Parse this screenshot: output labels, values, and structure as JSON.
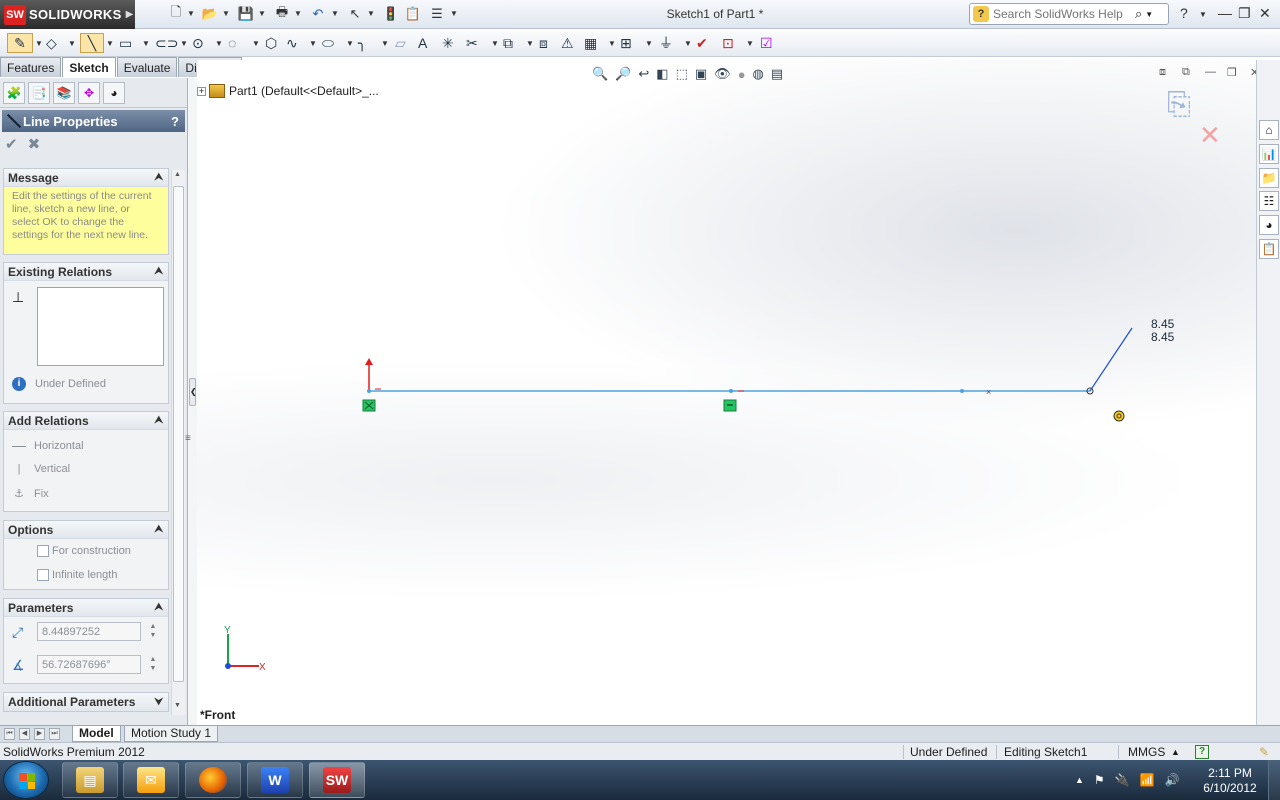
{
  "app": {
    "brand": "SOLIDWORKS",
    "document_title": "Sketch1 of Part1 *",
    "search_placeholder": "Search SolidWorks Help",
    "help_symbol": "?"
  },
  "command_tabs": [
    {
      "label": "Features",
      "active": false
    },
    {
      "label": "Sketch",
      "active": true
    },
    {
      "label": "Evaluate",
      "active": false
    },
    {
      "label": "DimXpert",
      "active": false
    }
  ],
  "property_manager": {
    "title": "Line Properties",
    "help": "?",
    "message_group": {
      "title": "Message",
      "text": "Edit the settings of the current line, sketch a new line, or select OK to change the settings for the next new line."
    },
    "existing_relations_group": {
      "title": "Existing Relations",
      "status": "Under Defined"
    },
    "add_relations_group": {
      "title": "Add Relations",
      "items": [
        "Horizontal",
        "Vertical",
        "Fix"
      ]
    },
    "options_group": {
      "title": "Options",
      "items": [
        "For construction",
        "Infinite length"
      ]
    },
    "parameters_group": {
      "title": "Parameters",
      "length": "8.44897252",
      "angle": "56.72687696°"
    },
    "additional_parameters_title": "Additional Parameters"
  },
  "graphics": {
    "tree_label": "Part1  (Default<<Default>_...",
    "view_name": "*Front",
    "dimension_line1": "8.45",
    "dimension_line2": "8.45",
    "triad": {
      "y": "Y",
      "x": "X"
    }
  },
  "bottom_tabs": [
    {
      "label": "Model",
      "active": true
    },
    {
      "label": "Motion Study 1",
      "active": false
    }
  ],
  "status_bar": {
    "product": "SolidWorks Premium 2012",
    "definition": "Under Defined",
    "mode": "Editing Sketch1",
    "units": "MMGS",
    "units_caret": "▲",
    "help": "?"
  },
  "taskbar": {
    "apps": [
      "Windows Explorer",
      "Outlook",
      "Firefox",
      "Microsoft Word",
      "SolidWorks"
    ],
    "clock_time": "2:11 PM",
    "clock_date": "6/10/2012"
  },
  "colors": {
    "sketch_line": "#4ea1e0",
    "relation_marker": "#22c55e",
    "origin_red": "#e11d1d",
    "rubber_band": "#1d4ed8"
  }
}
